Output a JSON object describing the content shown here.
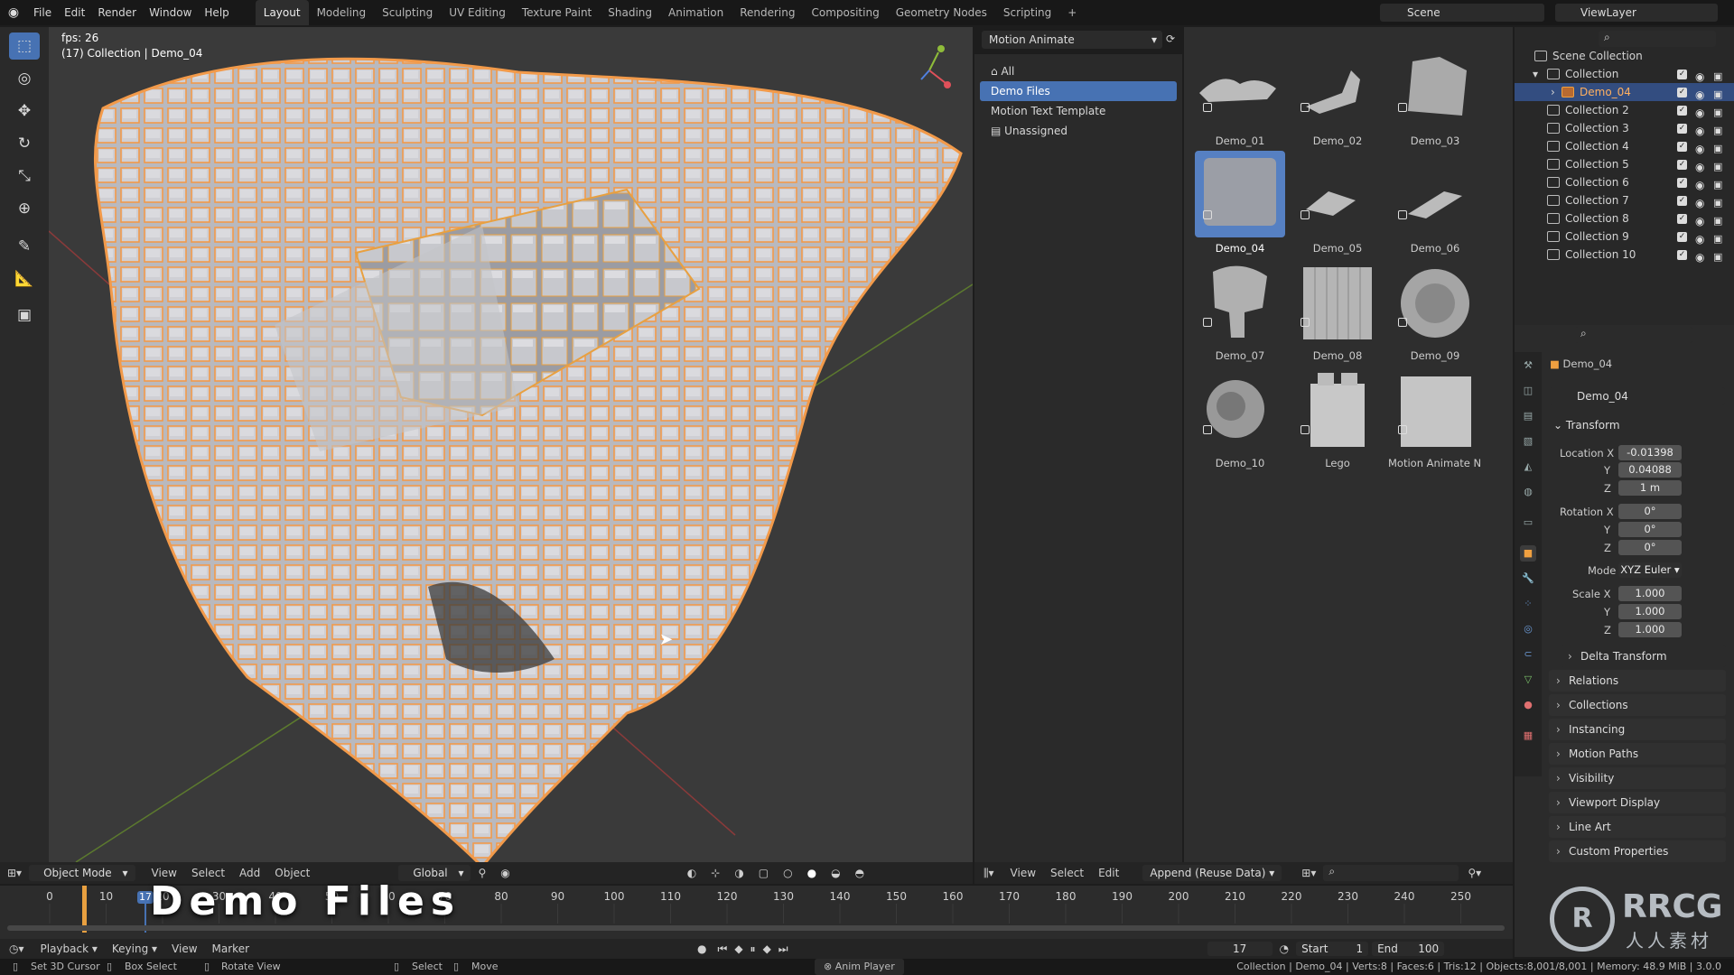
{
  "topbar": {
    "menus": [
      "File",
      "Edit",
      "Render",
      "Window",
      "Help"
    ],
    "workspaces": [
      "Layout",
      "Modeling",
      "Sculpting",
      "UV Editing",
      "Texture Paint",
      "Shading",
      "Animation",
      "Rendering",
      "Compositing",
      "Geometry Nodes",
      "Scripting"
    ],
    "active_workspace": "Layout",
    "scene": "Scene",
    "viewlayer": "ViewLayer"
  },
  "viewport": {
    "fps": "fps: 26",
    "info": "(17) Collection | Demo_04",
    "mode": "Object Mode",
    "menu": [
      "View",
      "Select",
      "Add",
      "Object"
    ],
    "orientation": "Global",
    "overlay_title": "Demo Files"
  },
  "asset_browser": {
    "library": "Motion Animate",
    "categories": [
      {
        "label": "All",
        "selected": false
      },
      {
        "label": "Demo Files",
        "selected": true
      },
      {
        "label": "Motion Text Template",
        "selected": false
      },
      {
        "label": "Unassigned",
        "selected": false
      }
    ],
    "assets": [
      "Demo_01",
      "Demo_02",
      "Demo_03",
      "Demo_04",
      "Demo_05",
      "Demo_06",
      "Demo_07",
      "Demo_08",
      "Demo_09",
      "Demo_10",
      "Lego",
      "Motion Animate N..."
    ],
    "selected_asset": "Demo_04",
    "footer_menu": [
      "View",
      "Select",
      "Edit"
    ],
    "import_method": "Append (Reuse Data)"
  },
  "outliner": {
    "root": "Scene Collection",
    "collection": "Collection",
    "active_object": "Demo_04",
    "collections": [
      "Collection 2",
      "Collection 3",
      "Collection 4",
      "Collection 5",
      "Collection 6",
      "Collection 7",
      "Collection 8",
      "Collection 9",
      "Collection 10"
    ]
  },
  "properties": {
    "object_name": "Demo_04",
    "data_name": "Demo_04",
    "transform_title": "Transform",
    "location_label": "Location X",
    "location": {
      "x": "-0.01398",
      "y": "0.04088",
      "z": "1 m"
    },
    "rotation_label": "Rotation X",
    "rotation": {
      "x": "0°",
      "y": "0°",
      "z": "0°"
    },
    "mode_label": "Mode",
    "mode": "XYZ Euler",
    "scale_label": "Scale X",
    "scale": {
      "x": "1.000",
      "y": "1.000",
      "z": "1.000"
    },
    "axis_y": "Y",
    "axis_z": "Z",
    "sections": [
      "Delta Transform",
      "Relations",
      "Collections",
      "Instancing",
      "Motion Paths",
      "Visibility",
      "Viewport Display",
      "Line Art",
      "Custom Properties"
    ]
  },
  "timeline": {
    "ticks": [
      "0",
      "10",
      "20",
      "30",
      "40",
      "50",
      "60",
      "70",
      "80",
      "90",
      "100",
      "110",
      "120",
      "130",
      "140",
      "150",
      "160",
      "170",
      "180",
      "190",
      "200",
      "210",
      "220",
      "230",
      "240",
      "250"
    ],
    "current_frame": "17",
    "menu": [
      "Playback",
      "Keying",
      "View",
      "Marker"
    ],
    "frame_field": "17",
    "start_label": "Start",
    "start": "1",
    "end_label": "End",
    "end": "100"
  },
  "statusbar": {
    "hints": [
      "Set 3D Cursor",
      "Box Select",
      "Rotate View",
      "Select",
      "Move"
    ],
    "anim_player": "Anim Player",
    "stats": "Collection | Demo_04 | Verts:8 | Faces:6 | Tris:12 | Objects:8,001/8,001 | Memory: 48.9 MiB | 3.0.0"
  },
  "watermark": "RRCG",
  "watermark_sub": "人人素材",
  "colors": {
    "accent": "#4772b3",
    "selection_outline": "#f29a4a",
    "active_orange": "#e8a040"
  }
}
